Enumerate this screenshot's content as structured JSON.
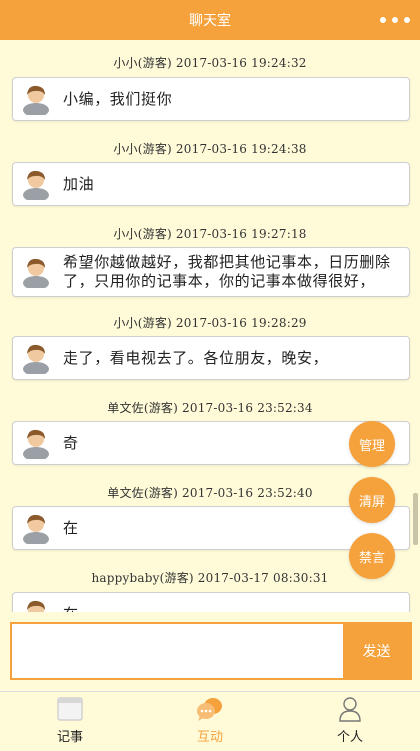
{
  "app": {
    "title": "聊天室",
    "accent_color": "#f5a23d",
    "background_color": "#fffbd9"
  },
  "header": {
    "more_icon": "more-dots-icon"
  },
  "messages": [
    {
      "meta": "小小(游客) 2017-03-16 19:24:32",
      "text": "小编，我们挺你"
    },
    {
      "meta": "小小(游客) 2017-03-16 19:24:38",
      "text": "加油"
    },
    {
      "meta": "小小(游客) 2017-03-16 19:27:18",
      "text_line1": "希望你越做越好，我都把其他记事本，日历删除",
      "text_line2": "了，只用你的记事本，你的记事本做得很好，"
    },
    {
      "meta": "小小(游客) 2017-03-16 19:28:29",
      "text": "走了，看电视去了。各位朋友，晚安，"
    },
    {
      "meta": "单文佐(游客) 2017-03-16 23:52:34",
      "text": "奇"
    },
    {
      "meta": "单文佐(游客) 2017-03-16 23:52:40",
      "text": "在"
    },
    {
      "meta": "happybaby(游客) 2017-03-17 08:30:31",
      "text": "在"
    }
  ],
  "actions": {
    "manage": "管理",
    "clear": "清屏",
    "mute": "禁言"
  },
  "composer": {
    "value": "",
    "placeholder": "",
    "send_label": "发送"
  },
  "tabs": [
    {
      "label": "记事",
      "icon": "notebook-icon",
      "active": false
    },
    {
      "label": "互动",
      "icon": "chat-bubble-icon",
      "active": true
    },
    {
      "label": "个人",
      "icon": "person-icon",
      "active": false
    }
  ]
}
